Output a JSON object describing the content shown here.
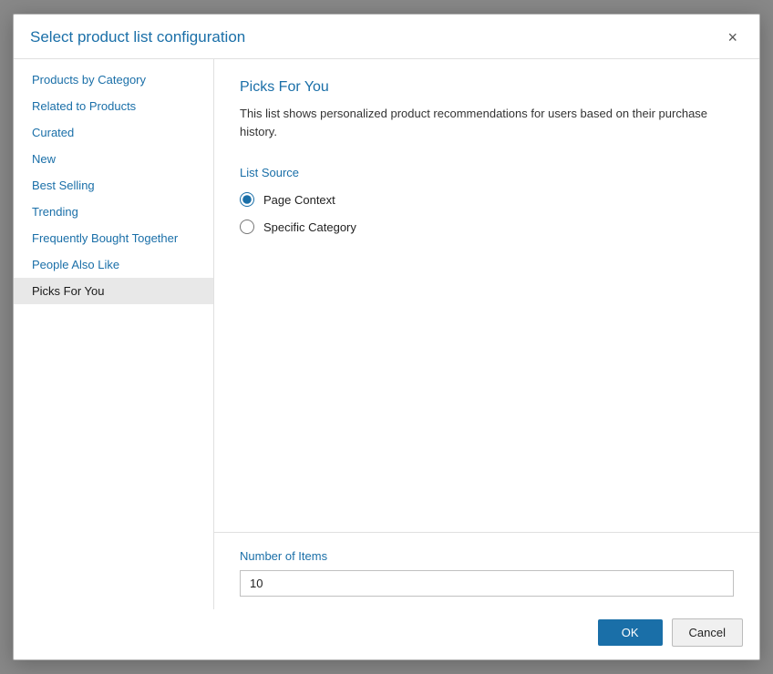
{
  "dialog": {
    "title": "Select product list configuration",
    "close_label": "×"
  },
  "sidebar": {
    "items": [
      {
        "id": "products-by-category",
        "label": "Products by Category",
        "active": false
      },
      {
        "id": "related-to-products",
        "label": "Related to Products",
        "active": false
      },
      {
        "id": "curated",
        "label": "Curated",
        "active": false
      },
      {
        "id": "new",
        "label": "New",
        "active": false
      },
      {
        "id": "best-selling",
        "label": "Best Selling",
        "active": false
      },
      {
        "id": "trending",
        "label": "Trending",
        "active": false
      },
      {
        "id": "frequently-bought-together",
        "label": "Frequently Bought Together",
        "active": false
      },
      {
        "id": "people-also-like",
        "label": "People Also Like",
        "active": false
      },
      {
        "id": "picks-for-you",
        "label": "Picks For You",
        "active": true
      }
    ]
  },
  "main": {
    "section_title": "Picks For You",
    "section_desc": "This list shows personalized product recommendations for users based on their purchase history.",
    "list_source_label": "List Source",
    "radio_options": [
      {
        "id": "page-context",
        "label": "Page Context",
        "checked": true
      },
      {
        "id": "specific-category",
        "label": "Specific Category",
        "checked": false
      }
    ],
    "number_of_items_label": "Number of Items",
    "number_of_items_value": "10",
    "number_of_items_placeholder": ""
  },
  "footer": {
    "ok_label": "OK",
    "cancel_label": "Cancel"
  }
}
